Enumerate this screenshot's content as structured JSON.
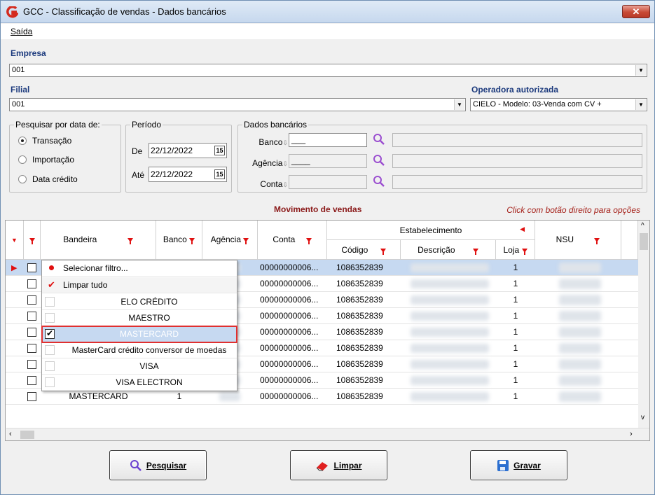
{
  "window": {
    "title": "GCC - Classificação de vendas - Dados bancários",
    "close_label": "✕"
  },
  "menu": {
    "saida": "Saída"
  },
  "empresa": {
    "label": "Empresa",
    "value": "001"
  },
  "filial": {
    "label": "Filial",
    "value": "001"
  },
  "operadora": {
    "label": "Operadora autorizada",
    "value": "CIELO - Modelo: 03-Venda com CV +"
  },
  "pesquisar": {
    "title": "Pesquisar por data de:",
    "options": [
      "Transação",
      "Importação",
      "Data crédito"
    ],
    "selected": "Transação"
  },
  "periodo": {
    "title": "Período",
    "de_label": "De",
    "de_value": "22/12/2022",
    "ate_label": "Até",
    "ate_value": "22/12/2022",
    "cal_label": "15"
  },
  "dados": {
    "title": "Dados bancários",
    "banco_label": "Banco",
    "agencia_label": "Agência",
    "conta_label": "Conta",
    "banco_value": "___",
    "agencia_value": "____"
  },
  "grid": {
    "caption": "Movimento de vendas",
    "hint": "Click com botão direito para opções",
    "headers": {
      "bandeira": "Bandeira",
      "banco": "Banco",
      "agencia": "Agência",
      "conta": "Conta",
      "estabelecimento": "Estabelecimento",
      "codigo": "Código",
      "descricao": "Descrição",
      "loja": "Loja",
      "nsu": "NSU"
    },
    "rows": [
      {
        "bandeira": "",
        "banco": "",
        "conta": "00000000006...",
        "codigo": "1086352839",
        "loja": "1"
      },
      {
        "bandeira": "",
        "banco": "",
        "conta": "00000000006...",
        "codigo": "1086352839",
        "loja": "1"
      },
      {
        "bandeira": "",
        "banco": "",
        "conta": "00000000006...",
        "codigo": "1086352839",
        "loja": "1"
      },
      {
        "bandeira": "",
        "banco": "",
        "conta": "00000000006...",
        "codigo": "1086352839",
        "loja": "1"
      },
      {
        "bandeira": "",
        "banco": "",
        "conta": "00000000006...",
        "codigo": "1086352839",
        "loja": "1"
      },
      {
        "bandeira": "",
        "banco": "",
        "conta": "00000000006...",
        "codigo": "1086352839",
        "loja": "1"
      },
      {
        "bandeira": "",
        "banco": "",
        "conta": "00000000006...",
        "codigo": "1086352839",
        "loja": "1"
      },
      {
        "bandeira": "MASTERCARD",
        "banco": "1",
        "conta": "00000000006...",
        "codigo": "1086352839",
        "loja": "1"
      },
      {
        "bandeira": "MASTERCARD",
        "banco": "1",
        "conta": "00000000006...",
        "codigo": "1086352839",
        "loja": "1"
      }
    ]
  },
  "filter_popup": {
    "select_filter": "Selecionar filtro...",
    "clear_all": "Limpar tudo",
    "items": [
      "ELO CRÉDITO",
      "MAESTRO",
      "MASTERCARD",
      "MasterCard crédito conversor de moedas",
      "VISA",
      "VISA ELECTRON"
    ],
    "checked": "MASTERCARD"
  },
  "buttons": {
    "pesquisar": "Pesquisar",
    "limpar": "Limpar",
    "gravar": "Gravar"
  },
  "colors": {
    "selected_item": "#c6d9f1",
    "highlight_border": "#e03030",
    "caption": "#8b1a1a",
    "label_blue": "#1c3a7d"
  }
}
